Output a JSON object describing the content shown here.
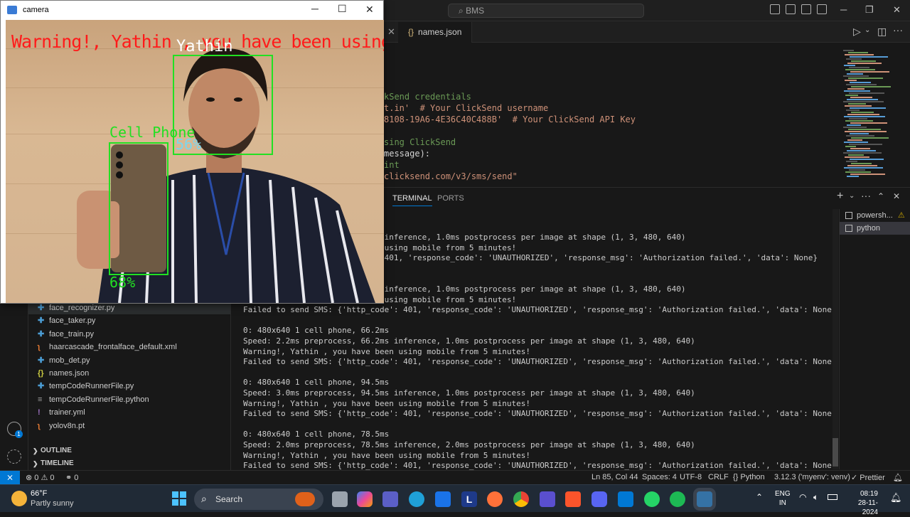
{
  "titlebar": {
    "command_center": "BMS"
  },
  "editor": {
    "tab_label": "names.json",
    "code_lines": [
      {
        "text": "kSend credentials",
        "cls": "c-green"
      },
      {
        "text": "t.in'  # Your ClickSend username",
        "cls": "c-orange"
      },
      {
        "text": "8108-19A6-4E36C40C488B'  # Your ClickSend API Key",
        "cls": "c-orange"
      },
      {
        "text": "",
        "cls": "c-white"
      },
      {
        "text": "sing ClickSend",
        "cls": "c-green"
      },
      {
        "text": "message):",
        "cls": "c-white"
      },
      {
        "text": "int",
        "cls": "c-green"
      },
      {
        "text": "clicksend.com/v3/sms/send\"",
        "cls": "c-orange"
      }
    ]
  },
  "panel": {
    "tabs": {
      "terminal": "TERMINAL",
      "ports": "PORTS"
    },
    "terminal_lines": [
      "                              inference, 1.0ms postprocess per image at shape (1, 3, 480, 640)",
      "                              using mobile from 5 minutes!",
      "                              401, 'response_code': 'UNAUTHORIZED', 'response_msg': 'Authorization failed.', 'data': None}",
      "",
      "",
      "                              inference, 1.0ms postprocess per image at shape (1, 3, 480, 640)",
      "                              using mobile from 5 minutes!",
      "Failed to send SMS: {'http_code': 401, 'response_code': 'UNAUTHORIZED', 'response_msg': 'Authorization failed.', 'data': None}",
      "",
      "0: 480x640 1 cell phone, 66.2ms",
      "Speed: 2.2ms preprocess, 66.2ms inference, 1.0ms postprocess per image at shape (1, 3, 480, 640)",
      "Warning!, Yathin , you have been using mobile from 5 minutes!",
      "Failed to send SMS: {'http_code': 401, 'response_code': 'UNAUTHORIZED', 'response_msg': 'Authorization failed.', 'data': None}",
      "",
      "0: 480x640 1 cell phone, 94.5ms",
      "Speed: 3.0ms preprocess, 94.5ms inference, 1.0ms postprocess per image at shape (1, 3, 480, 640)",
      "Warning!, Yathin , you have been using mobile from 5 minutes!",
      "Failed to send SMS: {'http_code': 401, 'response_code': 'UNAUTHORIZED', 'response_msg': 'Authorization failed.', 'data': None}",
      "",
      "0: 480x640 1 cell phone, 78.5ms",
      "Speed: 2.0ms preprocess, 78.5ms inference, 2.0ms postprocess per image at shape (1, 3, 480, 640)",
      "Warning!, Yathin , you have been using mobile from 5 minutes!",
      "Failed to send SMS: {'http_code': 401, 'response_code': 'UNAUTHORIZED', 'response_msg': 'Authorization failed.', 'data': None}"
    ],
    "terminals": [
      {
        "label": "powersh..."
      },
      {
        "label": "python"
      }
    ]
  },
  "explorer": {
    "files": [
      {
        "name": "face_recognizer.py",
        "icon": "python-icon",
        "glyph": "✚",
        "color": "#4b9cd3"
      },
      {
        "name": "face_taker.py",
        "icon": "python-icon",
        "glyph": "✚",
        "color": "#4b9cd3"
      },
      {
        "name": "face_train.py",
        "icon": "python-icon",
        "glyph": "✚",
        "color": "#4b9cd3"
      },
      {
        "name": "haarcascade_frontalface_default.xml",
        "icon": "rss-icon",
        "glyph": "ʅ",
        "color": "#e37933"
      },
      {
        "name": "mob_det.py",
        "icon": "python-icon",
        "glyph": "✚",
        "color": "#4b9cd3"
      },
      {
        "name": "names.json",
        "icon": "json-icon",
        "glyph": "{}",
        "color": "#cbcb41"
      },
      {
        "name": "tempCodeRunnerFile.py",
        "icon": "python-icon",
        "glyph": "✚",
        "color": "#4b9cd3"
      },
      {
        "name": "tempCodeRunnerFile.python",
        "icon": "lines-icon",
        "glyph": "≡",
        "color": "#a0a0a0"
      },
      {
        "name": "trainer.yml",
        "icon": "exclamation-icon",
        "glyph": "!",
        "color": "#a074c4"
      },
      {
        "name": "yolov8n.pt",
        "icon": "rss-icon",
        "glyph": "ʅ",
        "color": "#e37933"
      }
    ],
    "sections": {
      "outline": "OUTLINE",
      "timeline": "TIMELINE"
    }
  },
  "statusbar": {
    "errors": "0",
    "warnings": "0",
    "ports": "0",
    "position": "Ln 85, Col 44",
    "spaces": "Spaces: 4",
    "encoding": "UTF-8",
    "eol": "CRLF",
    "language": "Python",
    "interpreter": "3.12.3 ('myenv': venv)",
    "formatter": "Prettier"
  },
  "camera": {
    "window_title": "camera",
    "warning_text": "Warning!, Yathin , you have been using",
    "face_label": "Yathin",
    "face_confidence": "56%",
    "phone_label": "Cell Phone",
    "phone_confidence": "68%"
  },
  "taskbar": {
    "weather_temp": "66°F",
    "weather_desc": "Partly sunny",
    "search": "Search",
    "lang_1": "ENG",
    "lang_2": "IN",
    "time": "08:19",
    "date": "28-11-2024"
  }
}
